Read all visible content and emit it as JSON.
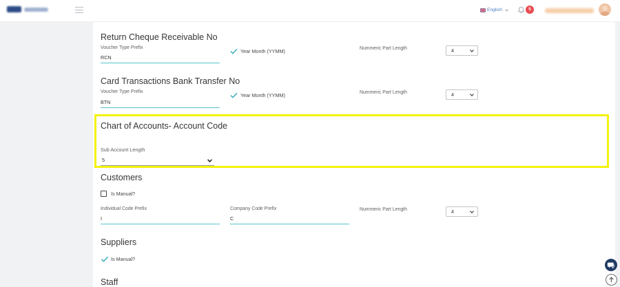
{
  "colors": {
    "accent": "#55c4ce",
    "check": "#2fa8b7",
    "highlight": "#f4f20c",
    "badge": "#e94b50",
    "chat": "#1f3a62",
    "link": "#4a7dc2"
  },
  "header": {
    "menu_icon": "hamburger-icon",
    "language": {
      "flag_icon": "uk-flag-icon",
      "label": "English",
      "dropdown_icon": "chevron-down-icon"
    },
    "notifications": {
      "icon": "bell-icon",
      "count": "5"
    },
    "user": {
      "avatar_icon": "user-avatar-icon"
    }
  },
  "return_cheque": {
    "title": "Return Cheque Receivable No",
    "prefix_label": "Voucher Type Prefix",
    "prefix_value": "RCN",
    "year_month_label": "Year Month (YYMM)",
    "year_month_checked": true,
    "numeric_label": "Nummeric Part Length",
    "numeric_value": "4"
  },
  "card_transfer": {
    "title": "Card Transactions Bank Transfer No",
    "prefix_label": "Voucher Type Prefix",
    "prefix_value": "BTN",
    "year_month_label": "Year Month (YYMM)",
    "year_month_checked": true,
    "numeric_label": "Nummeric Part Length",
    "numeric_value": "4"
  },
  "chart_of_accounts": {
    "title": "Chart of Accounts- Account Code",
    "sub_account_label": "Sub Account Length",
    "sub_account_value": "5"
  },
  "customers": {
    "title": "Customers",
    "manual_label": "Is Manual?",
    "manual_checked": false,
    "individual_label": "Individual Code Prefix",
    "individual_value": "I",
    "company_label": "Company Code Prefix",
    "company_value": "C",
    "numeric_label": "Nummeric Part Length",
    "numeric_value": "4"
  },
  "suppliers": {
    "title": "Suppliers",
    "manual_label": "Is Manual?",
    "manual_checked": true
  },
  "staff": {
    "title": "Staff"
  },
  "floating": {
    "chat_icon": "chat-bubble-icon",
    "scroll_top_icon": "arrow-up-icon"
  }
}
